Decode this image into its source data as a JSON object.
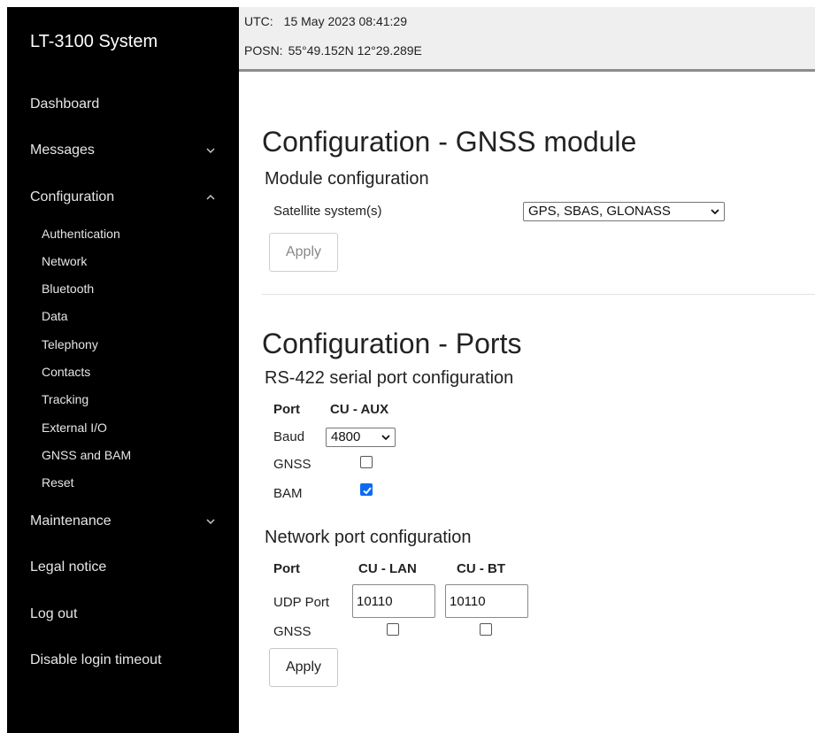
{
  "sidebar": {
    "brand": "LT-3100 System",
    "items": [
      {
        "label": "Dashboard"
      },
      {
        "label": "Messages",
        "chevron": "chevron-down-icon"
      },
      {
        "label": "Configuration",
        "chevron": "chevron-up-icon"
      },
      {
        "label": "Maintenance",
        "chevron": "chevron-down-icon"
      },
      {
        "label": "Legal notice"
      },
      {
        "label": "Log out"
      },
      {
        "label": "Disable login timeout"
      }
    ],
    "config_subitems": [
      {
        "label": "Authentication"
      },
      {
        "label": "Network"
      },
      {
        "label": "Bluetooth"
      },
      {
        "label": "Data"
      },
      {
        "label": "Telephony"
      },
      {
        "label": "Contacts"
      },
      {
        "label": "Tracking"
      },
      {
        "label": "External I/O"
      },
      {
        "label": "GNSS and BAM"
      },
      {
        "label": "Reset"
      }
    ]
  },
  "status": {
    "utc_label": "UTC:",
    "utc_value": "15 May 2023 08:41:29",
    "posn_label": "POSN:",
    "posn_value": "55°49.152N 12°29.289E"
  },
  "gnss": {
    "title": "Configuration - GNSS module",
    "subtitle": "Module configuration",
    "satellite_label": "Satellite system(s)",
    "satellite_value": "GPS, SBAS, GLONASS",
    "apply_label": "Apply"
  },
  "ports": {
    "title": "Configuration - Ports",
    "rs422": {
      "subtitle": "RS-422 serial port configuration",
      "port_header": "Port",
      "cu_aux_header": "CU - AUX",
      "baud_label": "Baud",
      "baud_value": "4800",
      "gnss_label": "GNSS",
      "gnss_checked": false,
      "bam_label": "BAM",
      "bam_checked": true
    },
    "network": {
      "subtitle": "Network port configuration",
      "port_header": "Port",
      "cu_lan_header": "CU - LAN",
      "cu_bt_header": "CU - BT",
      "udp_label": "UDP Port",
      "udp_lan_value": "10110",
      "udp_bt_value": "10110",
      "gnss_label": "GNSS",
      "gnss_lan_checked": false,
      "gnss_bt_checked": false
    },
    "apply_label": "Apply"
  },
  "colors": {
    "sidebar_bg": "#000000",
    "checkbox_accent": "#0a6bf2",
    "status_bg": "#efefef"
  }
}
